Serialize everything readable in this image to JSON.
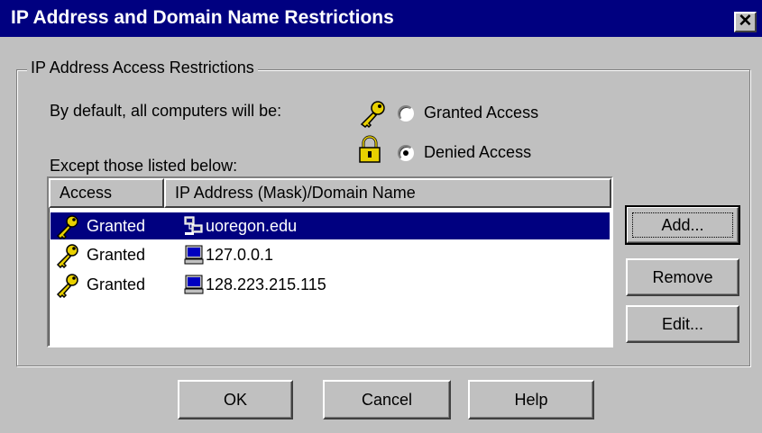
{
  "dialog": {
    "title": "IP Address and Domain Name Restrictions",
    "close_label": "✕"
  },
  "group": {
    "label": "IP Address Access Restrictions",
    "default_text": "By default, all computers will be:",
    "options": [
      {
        "label": "Granted Access",
        "selected": false,
        "icon": "key-icon"
      },
      {
        "label": "Denied Access",
        "selected": true,
        "icon": "lock-icon"
      }
    ],
    "except_text": "Except those listed below:"
  },
  "list": {
    "columns": [
      "Access",
      "IP Address (Mask)/Domain Name"
    ],
    "rows": [
      {
        "access": "Granted",
        "address": "uoregon.edu",
        "type_icon": "network-icon",
        "selected": true
      },
      {
        "access": "Granted",
        "address": "127.0.0.1",
        "type_icon": "computer-icon",
        "selected": false
      },
      {
        "access": "Granted",
        "address": "128.223.215.115",
        "type_icon": "computer-icon",
        "selected": false
      }
    ]
  },
  "side_buttons": {
    "add": "Add...",
    "remove": "Remove",
    "edit": "Edit..."
  },
  "footer": {
    "ok": "OK",
    "cancel": "Cancel",
    "help": "Help"
  },
  "colors": {
    "title_bar": "#000080",
    "face": "#c0c0c0",
    "selection": "#000080",
    "key_gold": "#e8d000"
  }
}
